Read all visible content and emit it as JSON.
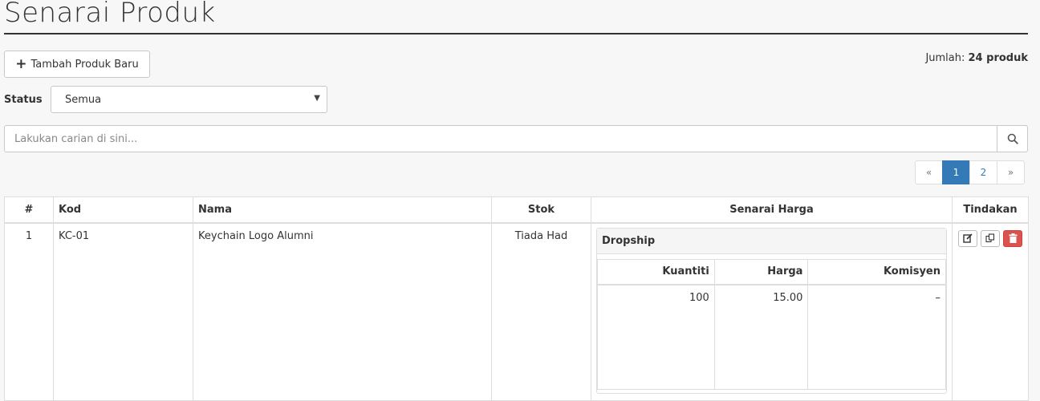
{
  "page": {
    "title": "Senarai Produk"
  },
  "toolbar": {
    "add_label": "Tambah Produk Baru"
  },
  "total": {
    "label": "Jumlah:",
    "value": "24 produk"
  },
  "filter": {
    "status_label": "Status",
    "status_value": "Semua"
  },
  "search": {
    "placeholder": "Lakukan carian di sini..."
  },
  "pagination": {
    "prev": "«",
    "pages": [
      "1",
      "2"
    ],
    "next": "»",
    "active": "1"
  },
  "table": {
    "headers": [
      "#",
      "Kod",
      "Nama",
      "Stok",
      "Senarai Harga",
      "Tindakan"
    ],
    "rows": [
      {
        "num": "1",
        "kod": "KC-01",
        "nama": "Keychain Logo Alumni",
        "stok": "Tiada Had",
        "price_list": {
          "title": "Dropship",
          "headers": [
            "Kuantiti",
            "Harga",
            "Komisyen"
          ],
          "rows": [
            [
              "100",
              "15.00",
              "–"
            ]
          ]
        }
      }
    ]
  },
  "colors": {
    "accent": "#337ab7",
    "danger": "#d9534f"
  },
  "icons": {
    "add": "plus-icon",
    "search": "search-icon",
    "edit": "edit-icon",
    "copy": "copy-icon",
    "delete": "trash-icon",
    "caret": "caret-down-icon"
  }
}
